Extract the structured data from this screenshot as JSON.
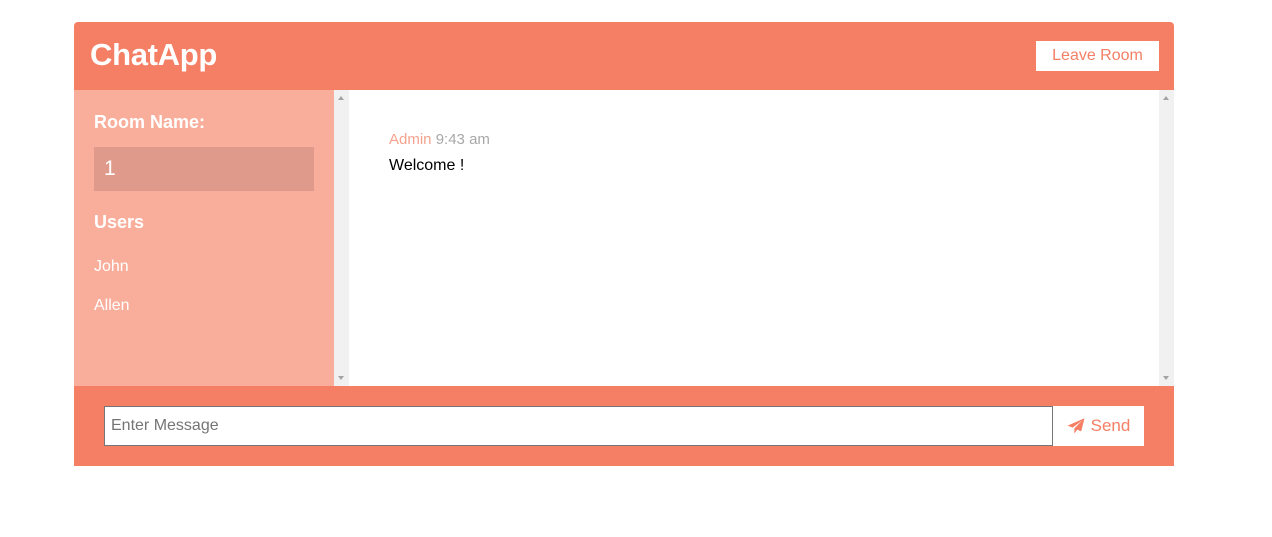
{
  "header": {
    "brand": "ChatApp",
    "leave_label": "Leave Room"
  },
  "sidebar": {
    "room_label": "Room Name:",
    "room_name": "1",
    "users_title": "Users",
    "users": [
      "John",
      "Allen"
    ]
  },
  "messages": [
    {
      "user": "Admin",
      "time": "9:43 am",
      "text": "Welcome !"
    }
  ],
  "composer": {
    "placeholder": "Enter Message",
    "value": "",
    "send_label": "Send",
    "send_icon": "paper-plane-icon"
  },
  "colors": {
    "accent": "#f47f64",
    "sidebar_bg": "#f9ae9b",
    "room_box_bg": "#e09a8c",
    "message_user": "#f4a28e",
    "message_time": "#a8a8a8"
  }
}
